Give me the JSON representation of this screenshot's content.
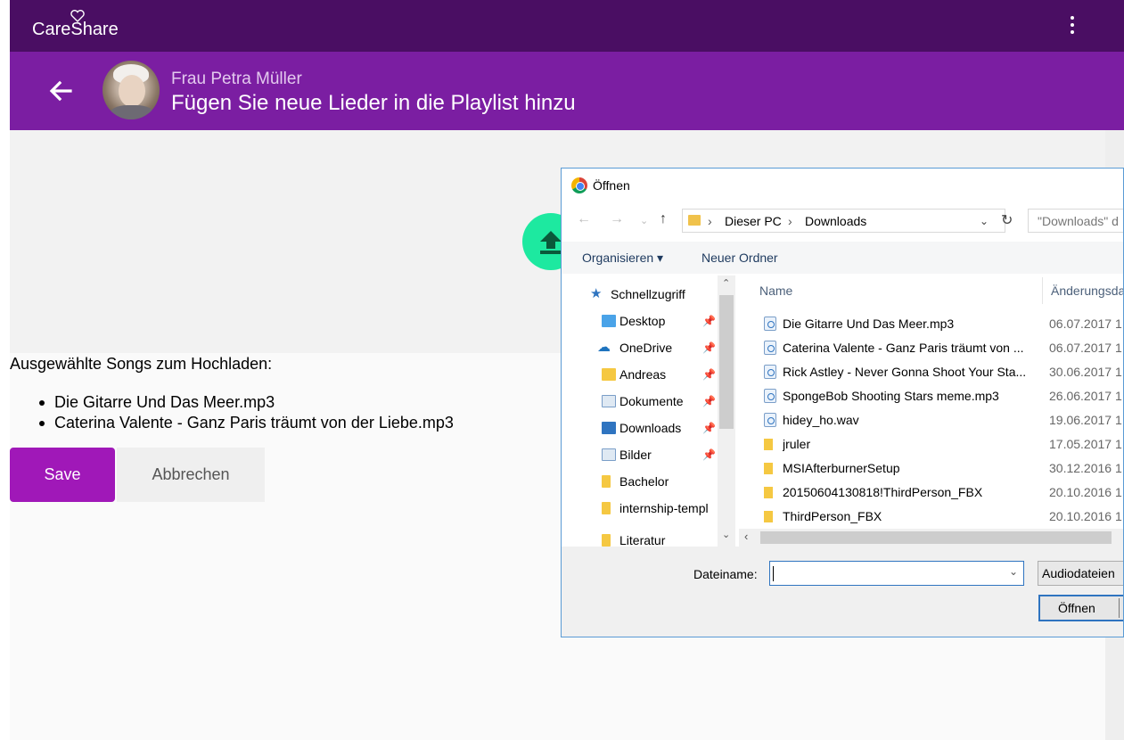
{
  "app": {
    "logo": "CareShare",
    "person_name": "Frau Petra Müller",
    "page_title": "Fügen Sie neue Lieder in die Playlist hinzu"
  },
  "selection": {
    "heading": "Ausgewählte Songs zum Hochladen:",
    "songs": [
      "Die Gitarre Und Das Meer.mp3",
      "Caterina Valente - Ganz Paris träumt von der Liebe.mp3"
    ]
  },
  "actions": {
    "save": "Save",
    "cancel": "Abbrechen"
  },
  "dialog": {
    "title": "Öffnen",
    "breadcrumb": [
      "Dieser PC",
      "Downloads"
    ],
    "search_placeholder": "\"Downloads\" d",
    "toolbar": {
      "organize": "Organisieren",
      "new_folder": "Neuer Ordner"
    },
    "nav_items": [
      {
        "label": "Schnellzugriff",
        "icon": "star-icon",
        "pinned": false
      },
      {
        "label": "Desktop",
        "icon": "desktop-folder-icon",
        "pinned": true
      },
      {
        "label": "OneDrive",
        "icon": "cloud-icon",
        "pinned": true
      },
      {
        "label": "Andreas",
        "icon": "user-folder-icon",
        "pinned": true
      },
      {
        "label": "Dokumente",
        "icon": "documents-folder-icon",
        "pinned": true
      },
      {
        "label": "Downloads",
        "icon": "downloads-folder-icon",
        "pinned": true
      },
      {
        "label": "Bilder",
        "icon": "pictures-folder-icon",
        "pinned": true
      },
      {
        "label": "Bachelor",
        "icon": "folder-icon",
        "pinned": false
      },
      {
        "label": "internship-templ",
        "icon": "folder-icon",
        "pinned": false
      },
      {
        "label": "Literatur",
        "icon": "folder-icon",
        "pinned": false
      }
    ],
    "columns": {
      "name": "Name",
      "modified": "Änderungsda"
    },
    "files": [
      {
        "name": "Die Gitarre Und Das Meer.mp3",
        "date": "06.07.2017 1",
        "type": "audio"
      },
      {
        "name": "Caterina Valente - Ganz Paris träumt von ...",
        "date": "06.07.2017 1",
        "type": "audio"
      },
      {
        "name": "Rick Astley - Never Gonna Shoot Your Sta...",
        "date": "30.06.2017 1",
        "type": "audio"
      },
      {
        "name": "SpongeBob Shooting Stars meme.mp3",
        "date": "26.06.2017 1",
        "type": "audio"
      },
      {
        "name": "hidey_ho.wav",
        "date": "19.06.2017 1",
        "type": "audio"
      },
      {
        "name": "jruler",
        "date": "17.05.2017 1",
        "type": "folder"
      },
      {
        "name": "MSIAfterburnerSetup",
        "date": "30.12.2016 1",
        "type": "folder"
      },
      {
        "name": "20150604130818!ThirdPerson_FBX",
        "date": "20.10.2016 1",
        "type": "folder"
      },
      {
        "name": "ThirdPerson_FBX",
        "date": "20.10.2016 1",
        "type": "folder"
      }
    ],
    "filename_label": "Dateiname:",
    "filename_value": "",
    "filetype": "Audiodateien",
    "open_button": "Öffnen"
  },
  "colors": {
    "topbar": "#4a0e63",
    "header": "#7b1ea2",
    "save_button": "#a018b8",
    "upload_fab": "#1de9a0",
    "dialog_border": "#5a9bd5"
  }
}
